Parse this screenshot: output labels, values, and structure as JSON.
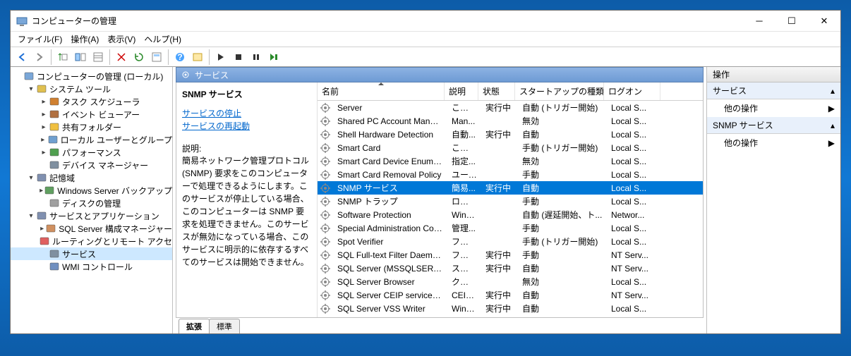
{
  "title": "コンピューターの管理",
  "menus": [
    "ファイル(F)",
    "操作(A)",
    "表示(V)",
    "ヘルプ(H)"
  ],
  "tree": [
    {
      "lvl": 0,
      "exp": "",
      "label": "コンピューターの管理 (ローカル)",
      "icon": "pc"
    },
    {
      "lvl": 1,
      "exp": "v",
      "label": "システム ツール",
      "icon": "tools"
    },
    {
      "lvl": 2,
      "exp": ">",
      "label": "タスク スケジューラ",
      "icon": "clock"
    },
    {
      "lvl": 2,
      "exp": ">",
      "label": "イベント ビューアー",
      "icon": "book"
    },
    {
      "lvl": 2,
      "exp": ">",
      "label": "共有フォルダー",
      "icon": "folder"
    },
    {
      "lvl": 2,
      "exp": ">",
      "label": "ローカル ユーザーとグループ",
      "icon": "users"
    },
    {
      "lvl": 2,
      "exp": ">",
      "label": "パフォーマンス",
      "icon": "perf"
    },
    {
      "lvl": 2,
      "exp": "",
      "label": "デバイス マネージャー",
      "icon": "device"
    },
    {
      "lvl": 1,
      "exp": "v",
      "label": "記憶域",
      "icon": "storage"
    },
    {
      "lvl": 2,
      "exp": ">",
      "label": "Windows Server バックアップ",
      "icon": "backup"
    },
    {
      "lvl": 2,
      "exp": "",
      "label": "ディスクの管理",
      "icon": "disk"
    },
    {
      "lvl": 1,
      "exp": "v",
      "label": "サービスとアプリケーション",
      "icon": "svcapp"
    },
    {
      "lvl": 2,
      "exp": ">",
      "label": "SQL Server 構成マネージャー",
      "icon": "sql"
    },
    {
      "lvl": 2,
      "exp": "",
      "label": "ルーティングとリモート アクセス",
      "icon": "route"
    },
    {
      "lvl": 2,
      "exp": "",
      "label": "サービス",
      "icon": "gear",
      "sel": true
    },
    {
      "lvl": 2,
      "exp": "",
      "label": "WMI コントロール",
      "icon": "wmi"
    }
  ],
  "mid_title": "サービス",
  "detail": {
    "title": "SNMP サービス",
    "link_stop": "サービスの停止",
    "link_restart": "サービスの再起動",
    "desc_label": "説明:",
    "desc": "簡易ネットワーク管理プロトコル (SNMP) 要求をこのコンピューターで処理できるようにします。このサービスが停止している場合、このコンピューターは SNMP 要求を処理できません。このサービスが無効になっている場合、このサービスに明示的に依存するすべてのサービスは開始できません。"
  },
  "cols": {
    "name": "名前",
    "desc": "説明",
    "stat": "状態",
    "start": "スタートアップの種類",
    "logon": "ログオン"
  },
  "rows": [
    {
      "name": "Server",
      "desc": "このコ...",
      "stat": "実行中",
      "start": "自動 (トリガー開始)",
      "logon": "Local S..."
    },
    {
      "name": "Shared PC Account Manager",
      "desc": "Man...",
      "stat": "",
      "start": "無効",
      "logon": "Local S..."
    },
    {
      "name": "Shell Hardware Detection",
      "desc": "自動...",
      "stat": "実行中",
      "start": "自動",
      "logon": "Local S..."
    },
    {
      "name": "Smart Card",
      "desc": "このコ...",
      "stat": "",
      "start": "手動 (トリガー開始)",
      "logon": "Local S..."
    },
    {
      "name": "Smart Card Device Enumera...",
      "desc": "指定...",
      "stat": "",
      "start": "無効",
      "logon": "Local S..."
    },
    {
      "name": "Smart Card Removal Policy",
      "desc": "ユーザ...",
      "stat": "",
      "start": "手動",
      "logon": "Local S..."
    },
    {
      "name": "SNMP サービス",
      "desc": "簡易...",
      "stat": "実行中",
      "start": "自動",
      "logon": "Local S...",
      "sel": true
    },
    {
      "name": "SNMP トラップ",
      "desc": "ローカ...",
      "stat": "",
      "start": "手動",
      "logon": "Local S..."
    },
    {
      "name": "Software Protection",
      "desc": "Wind...",
      "stat": "",
      "start": "自動 (遅延開始、ト...",
      "logon": "Networ..."
    },
    {
      "name": "Special Administration Cons...",
      "desc": "管理...",
      "stat": "",
      "start": "手動",
      "logon": "Local S..."
    },
    {
      "name": "Spot Verifier",
      "desc": "ファイ...",
      "stat": "",
      "start": "手動 (トリガー開始)",
      "logon": "Local S..."
    },
    {
      "name": "SQL Full-text Filter Daemon ...",
      "desc": "フルテ...",
      "stat": "実行中",
      "start": "手動",
      "logon": "NT Serv..."
    },
    {
      "name": "SQL Server (MSSQLSERVER)",
      "desc": "ストレ...",
      "stat": "実行中",
      "start": "自動",
      "logon": "NT Serv..."
    },
    {
      "name": "SQL Server Browser",
      "desc": "クライ...",
      "stat": "",
      "start": "無効",
      "logon": "Local S..."
    },
    {
      "name": "SQL Server CEIP service (MS...",
      "desc": "CEIP ...",
      "stat": "実行中",
      "start": "自動",
      "logon": "NT Serv..."
    },
    {
      "name": "SQL Server VSS Writer",
      "desc": "Wind...",
      "stat": "実行中",
      "start": "自動",
      "logon": "Local S..."
    }
  ],
  "tabs": {
    "ext": "拡張",
    "std": "標準"
  },
  "actions": {
    "title": "操作",
    "sec1": "サービス",
    "more": "他の操作",
    "sec2": "SNMP サービス"
  }
}
